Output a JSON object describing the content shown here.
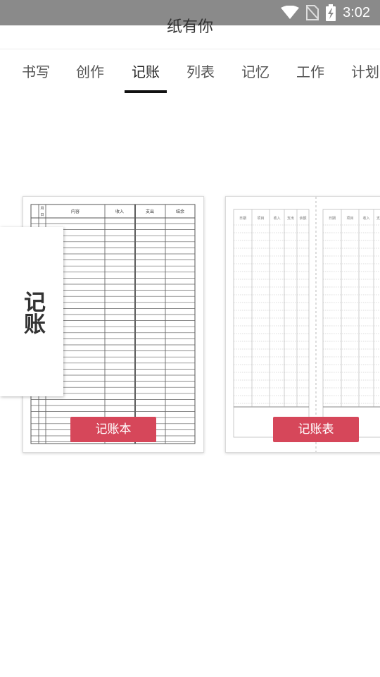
{
  "status_bar": {
    "time": "3:02",
    "icons": [
      "wifi-icon",
      "no-sim-icon",
      "battery-charging-icon"
    ]
  },
  "header": {
    "title": "纸有你"
  },
  "tabs": [
    {
      "label": "书写"
    },
    {
      "label": "创作"
    },
    {
      "label": "记账",
      "active": true
    },
    {
      "label": "列表"
    },
    {
      "label": "记忆"
    },
    {
      "label": "工作"
    },
    {
      "label": "计划"
    }
  ],
  "category_tag": {
    "label": "记账"
  },
  "templates": [
    {
      "label": "记账本",
      "preview": {
        "month_header": "月",
        "day_header": "日",
        "columns": [
          "内容",
          "收入",
          "支出",
          "结余"
        ]
      }
    },
    {
      "label": "记账表",
      "preview": {
        "columns": [
          "日期",
          "项目",
          "收入",
          "支出",
          "余额"
        ]
      }
    }
  ],
  "colors": {
    "accent": "#d6475a",
    "status_bar": "#8a8a8a",
    "tab_indicator": "#111111"
  }
}
